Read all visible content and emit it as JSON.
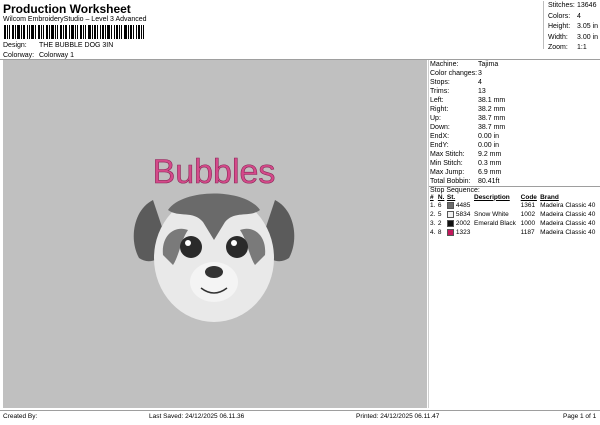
{
  "header": {
    "title": "Production Worksheet",
    "subtitle": "Wilcom EmbroideryStudio – Level 3 Advanced",
    "design_label": "Design:",
    "design_value": "THE BUBBLE DOG 3IN",
    "colorway_label": "Colorway:",
    "colorway_value": "Colorway 1"
  },
  "stats": [
    {
      "label": "Stitches:",
      "value": "13646"
    },
    {
      "label": "Colors:",
      "value": "4"
    },
    {
      "label": "Height:",
      "value": "3.05 in"
    },
    {
      "label": "Width:",
      "value": "3.00 in"
    },
    {
      "label": "Zoom:",
      "value": "1:1"
    }
  ],
  "design": {
    "text": "Bubbles",
    "text_color": "#d44a8a",
    "background_color": "#c0c0c0"
  },
  "machine_info": [
    {
      "label": "Machine:",
      "value": "Tajima"
    },
    {
      "label": "Color changes:",
      "value": "3"
    },
    {
      "label": "Stops:",
      "value": "4"
    },
    {
      "label": "Trims:",
      "value": "13"
    },
    {
      "label": "Left:",
      "value": "38.1 mm"
    },
    {
      "label": "Right:",
      "value": "38.2 mm"
    },
    {
      "label": "Up:",
      "value": "38.7 mm"
    },
    {
      "label": "Down:",
      "value": "38.7 mm"
    },
    {
      "label": "EndX:",
      "value": "0.00 in"
    },
    {
      "label": "EndY:",
      "value": "0.00 in"
    },
    {
      "label": "Max Stitch:",
      "value": "9.2 mm"
    },
    {
      "label": "Min Stitch:",
      "value": "0.3 mm"
    },
    {
      "label": "Max Jump:",
      "value": "6.9 mm"
    },
    {
      "label": "Total Bobbin:",
      "value": "80.41ft"
    }
  ],
  "stop_sequence": {
    "label": "Stop Sequence:",
    "columns": [
      "#",
      "N.",
      "St.",
      "Description",
      "Code",
      "Brand"
    ],
    "rows": [
      {
        "num": "1.",
        "n": "6",
        "st": "4485",
        "desc": "",
        "code": "1361",
        "brand": "Madeira Classic 40",
        "color": "#6b6b6b"
      },
      {
        "num": "2.",
        "n": "5",
        "st": "5834",
        "desc": "Snow White",
        "code": "1002",
        "brand": "Madeira Classic 40",
        "color": "#f2f2f2"
      },
      {
        "num": "3.",
        "n": "2",
        "st": "2002",
        "desc": "Emerald Black",
        "code": "1000",
        "brand": "Madeira Classic 40",
        "color": "#111111"
      },
      {
        "num": "4.",
        "n": "8",
        "st": "1323",
        "desc": "",
        "code": "1187",
        "brand": "Madeira Classic 40",
        "color": "#c2185b"
      }
    ]
  },
  "footer": {
    "created_by": "Created By:",
    "last_saved": "Last Saved: 24/12/2025 06.11.36",
    "printed": "Printed: 24/12/2025 06.11.47",
    "page": "Page 1 of 1"
  }
}
